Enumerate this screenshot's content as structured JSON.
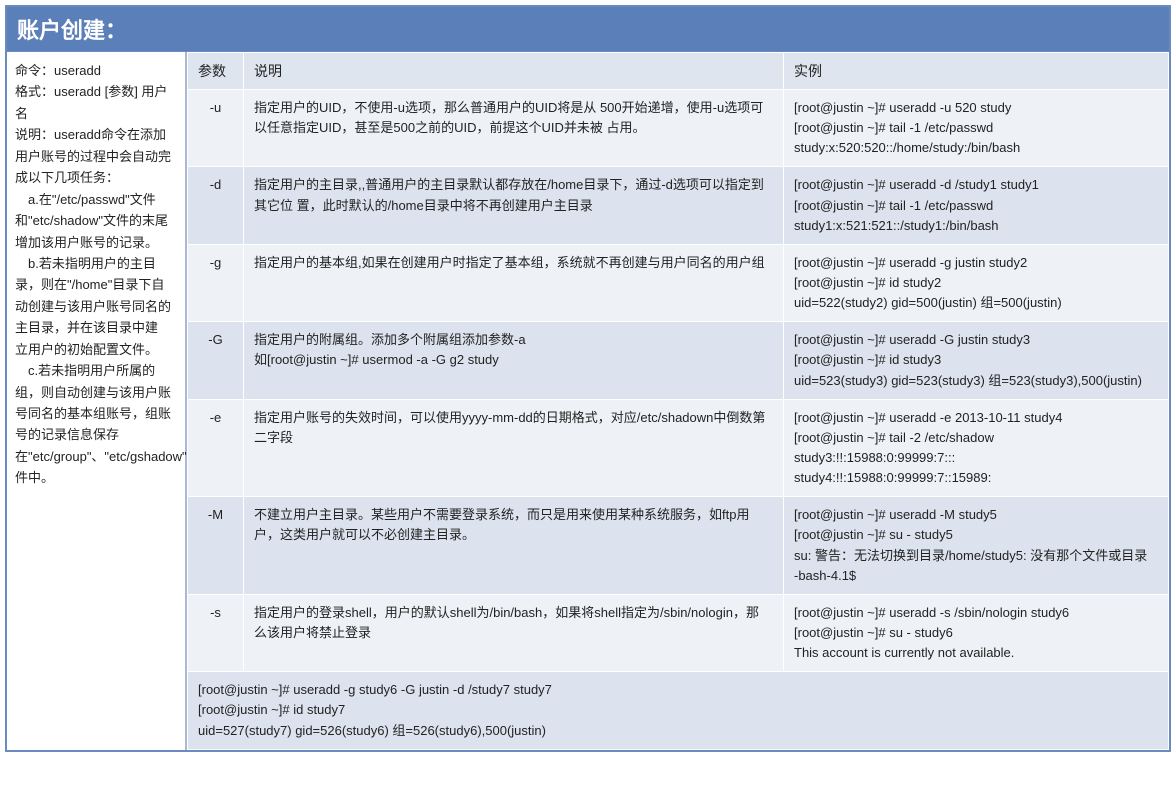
{
  "title": "账户创建：",
  "left": {
    "cmd_label": "命令：useradd",
    "fmt_label": "格式：useradd [参数] 用户名",
    "desc_label": "说明：useradd命令在添加用户账号的过程中会自动完成以下几项任务：",
    "a": "　a.在\"/etc/passwd\"文件和\"etc/shadow\"文件的末尾增加该用户账号的记录。",
    "b": "　b.若未指明用户的主目录，则在\"/home\"目录下自动创建与该用户账号同名的主目录，并在该目录中建　　　立用户的初始配置文件。",
    "c": "　c.若未指明用户所属的组，则自动创建与该用户账号同名的基本组账号，组账号的记录信息保存 在\"etc/group\"、\"etc/gshadow\"文件中。"
  },
  "headers": {
    "param": "参数",
    "desc": "说明",
    "example": "实例"
  },
  "rows": [
    {
      "param": "-u",
      "desc": "指定用户的UID，不使用-u选项，那么普通用户的UID将是从 500开始递增，使用-u选项可以任意指定UID，甚至是500之前的UID，前提这个UID并未被 占用。",
      "example": "[root@justin ~]# useradd -u 520 study\n[root@justin ~]# tail -1 /etc/passwd\nstudy:x:520:520::/home/study:/bin/bash"
    },
    {
      "param": "-d",
      "desc": "指定用户的主目录,,普通用户的主目录默认都存放在/home目录下，通过-d选项可以指定到其它位 置，此时默认的/home目录中将不再创建用户主目录",
      "example": "[root@justin ~]# useradd -d /study1 study1\n[root@justin ~]# tail -1 /etc/passwd\nstudy1:x:521:521::/study1:/bin/bash"
    },
    {
      "param": "-g",
      "desc": "指定用户的基本组,如果在创建用户时指定了基本组，系统就不再创建与用户同名的用户组",
      "example": "[root@justin ~]# useradd -g justin study2\n[root@justin ~]# id study2\nuid=522(study2) gid=500(justin) 组=500(justin)"
    },
    {
      "param": "-G",
      "desc": "指定用户的附属组。添加多个附属组添加参数-a\n如[root@justin ~]# usermod -a -G g2 study",
      "example": "[root@justin ~]# useradd -G justin study3\n[root@justin ~]# id study3\nuid=523(study3) gid=523(study3) 组=523(study3),500(justin)"
    },
    {
      "param": "-e",
      "desc": "指定用户账号的失效时间，可以使用yyyy-mm-dd的日期格式，对应/etc/shadown中倒数第二字段",
      "example": "[root@justin ~]# useradd -e 2013-10-11 study4\n[root@justin ~]# tail -2 /etc/shadow\nstudy3:!!:15988:0:99999:7:::\nstudy4:!!:15988:0:99999:7::15989:"
    },
    {
      "param": "-M",
      "desc": "不建立用户主目录。某些用户不需要登录系统，而只是用来使用某种系统服务，如ftp用户，这类用户就可以不必创建主目录。",
      "example": "[root@justin ~]# useradd -M study5\n[root@justin ~]# su - study5\nsu: 警告：无法切换到目录/home/study5: 没有那个文件或目录\n-bash-4.1$"
    },
    {
      "param": "-s",
      "desc": "指定用户的登录shell，用户的默认shell为/bin/bash，如果将shell指定为/sbin/nologin，那 么该用户将禁止登录",
      "example": "[root@justin ~]# useradd -s /sbin/nologin study6\n[root@justin ~]# su - study6\nThis account is currently not available."
    }
  ],
  "footer": "[root@justin ~]# useradd -g study6 -G justin -d /study7 study7\n[root@justin ~]# id study7\nuid=527(study7) gid=526(study6) 组=526(study6),500(justin)"
}
